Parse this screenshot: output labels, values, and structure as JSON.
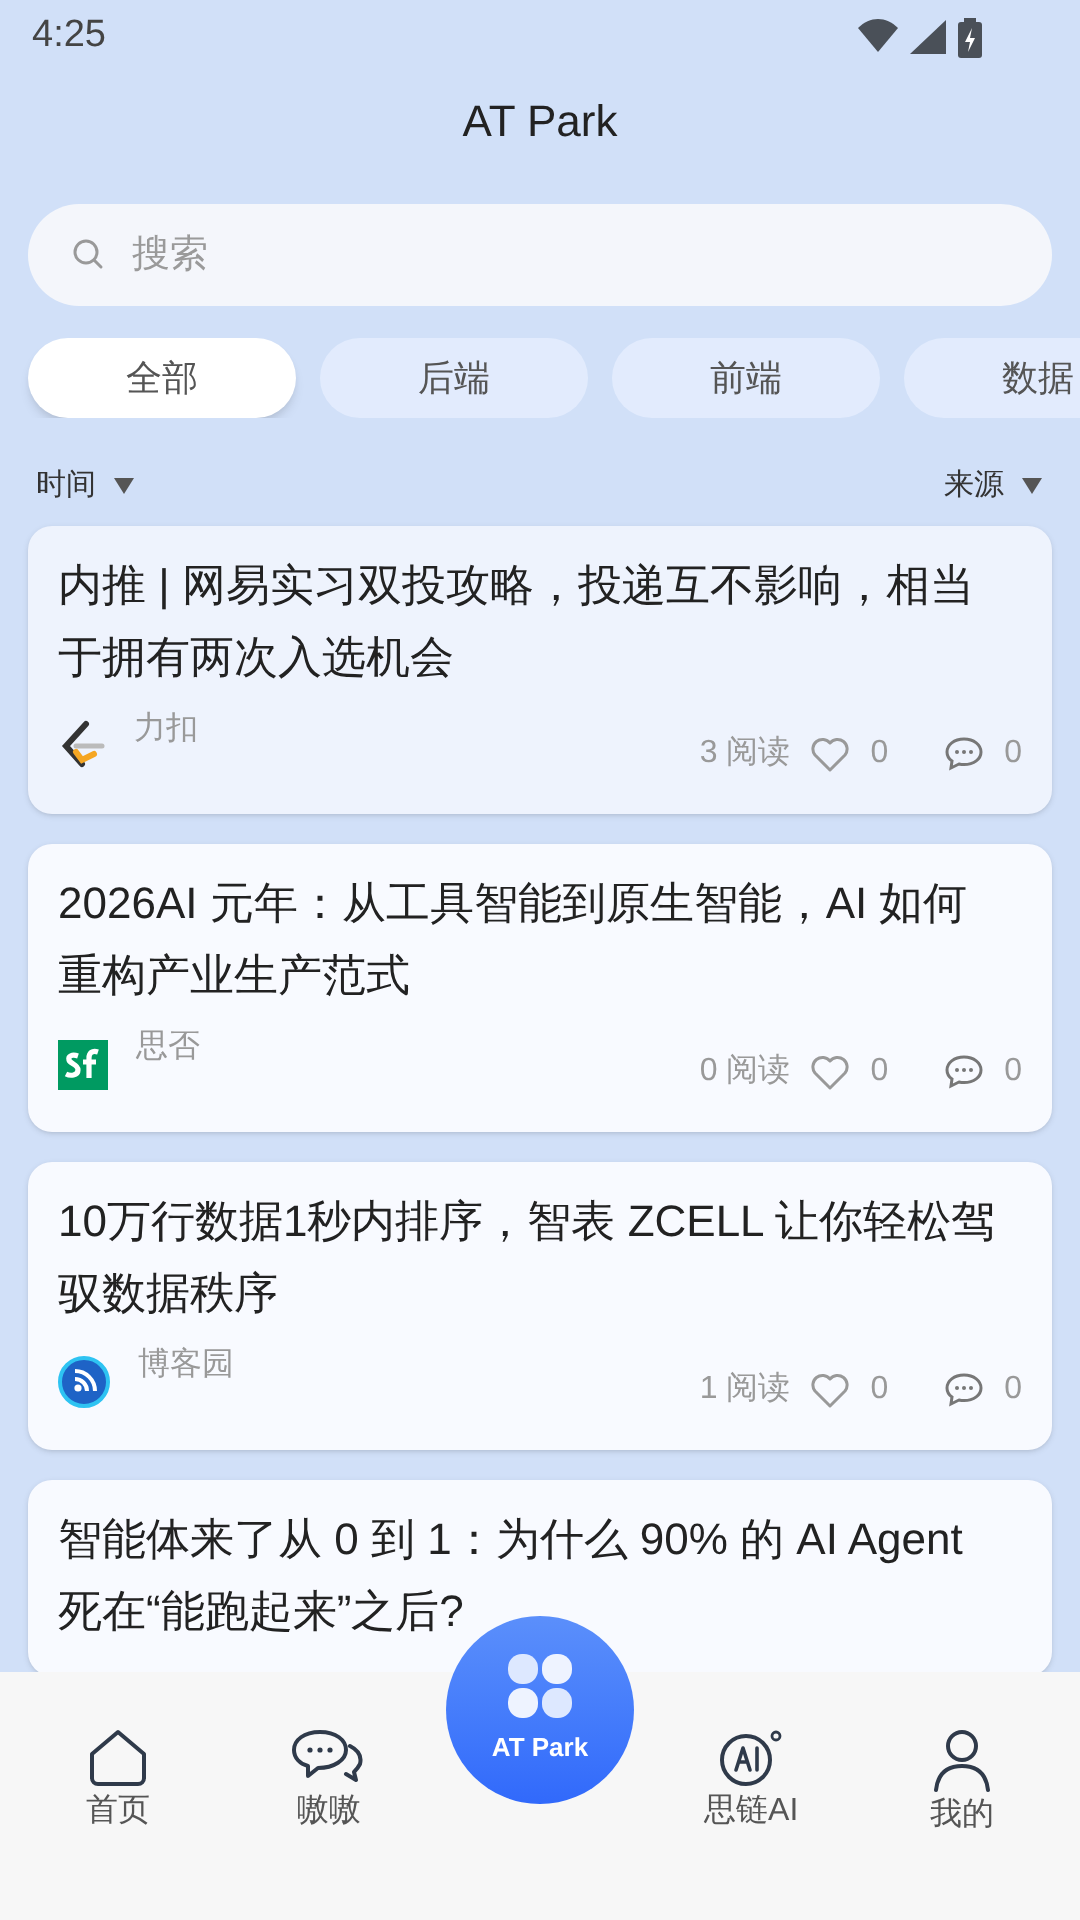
{
  "status_bar": {
    "time": "4:25"
  },
  "header": {
    "title": "AT Park"
  },
  "search": {
    "placeholder": "搜索"
  },
  "chips": [
    {
      "label": "全部",
      "selected": true
    },
    {
      "label": "后端",
      "selected": false
    },
    {
      "label": "前端",
      "selected": false
    },
    {
      "label": "数据",
      "selected": false
    }
  ],
  "sort": {
    "left": "时间",
    "right": "来源"
  },
  "articles": [
    {
      "title": "内推 | 网易实习双投攻略，投递互不影响，相当于拥有两次入选机会",
      "source": "力扣",
      "kind": "leetcode",
      "reads": "3 阅读",
      "likes": "0",
      "comments": "0"
    },
    {
      "title": "2026AI 元年：从工具智能到原生智能，AI 如何重构产业生产范式",
      "source": "思否",
      "kind": "sf",
      "reads": "0 阅读",
      "likes": "0",
      "comments": "0"
    },
    {
      "title": "10万行数据1秒内排序，智表 ZCELL 让你轻松驾驭数据秩序",
      "source": "博客园",
      "kind": "rss",
      "reads": "1 阅读",
      "likes": "0",
      "comments": "0"
    },
    {
      "title": "智能体来了从 0 到 1：为什么 90% 的 AI Agent 死在“能跑起来”之后?"
    }
  ],
  "nav": [
    {
      "kind": "home",
      "label": "首页"
    },
    {
      "kind": "chat",
      "label": "嗷嗷"
    },
    {
      "kind": "center",
      "label": "AT Park"
    },
    {
      "kind": "ai",
      "label": "思链AI"
    },
    {
      "kind": "user",
      "label": "我的"
    }
  ]
}
